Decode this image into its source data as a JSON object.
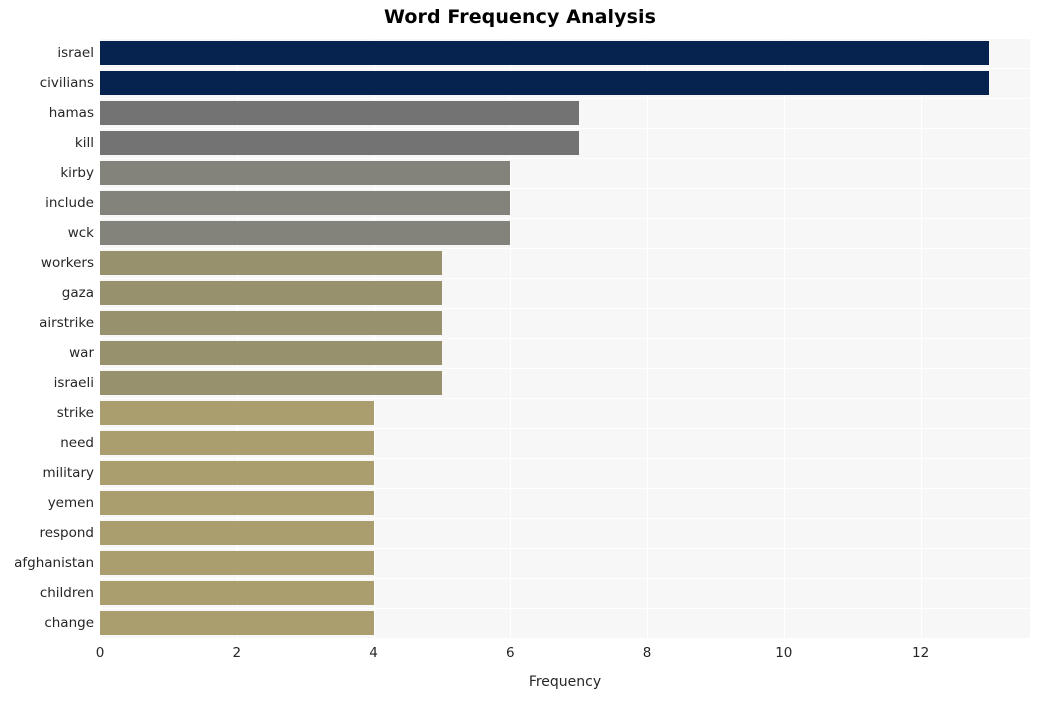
{
  "chart_data": {
    "type": "bar",
    "orientation": "horizontal",
    "title": "Word Frequency Analysis",
    "xlabel": "Frequency",
    "ylabel": "",
    "categories": [
      "israel",
      "civilians",
      "hamas",
      "kill",
      "kirby",
      "include",
      "wck",
      "workers",
      "gaza",
      "airstrike",
      "war",
      "israeli",
      "strike",
      "need",
      "military",
      "yemen",
      "respond",
      "afghanistan",
      "children",
      "change"
    ],
    "values": [
      13,
      13,
      7,
      7,
      6,
      6,
      6,
      5,
      5,
      5,
      5,
      5,
      4,
      4,
      4,
      4,
      4,
      4,
      4,
      4
    ],
    "bar_colors": [
      "#06234f",
      "#06234f",
      "#737373",
      "#737373",
      "#84837b",
      "#84837b",
      "#84837b",
      "#97916e",
      "#97916e",
      "#97916e",
      "#97916e",
      "#97916e",
      "#aa9e6e",
      "#aa9e6e",
      "#aa9e6e",
      "#aa9e6e",
      "#aa9e6e",
      "#aa9e6e",
      "#aa9e6e",
      "#aa9e6e"
    ],
    "xlim": [
      0,
      13.6
    ],
    "xticks": [
      0,
      2,
      4,
      6,
      8,
      10,
      12
    ],
    "xtick_labels": [
      "0",
      "2",
      "4",
      "6",
      "8",
      "10",
      "12"
    ],
    "grid": true,
    "grid_color": "#ffffff",
    "plot_background": "#f7f7f7",
    "figure_background": "#ffffff",
    "legend": null
  }
}
